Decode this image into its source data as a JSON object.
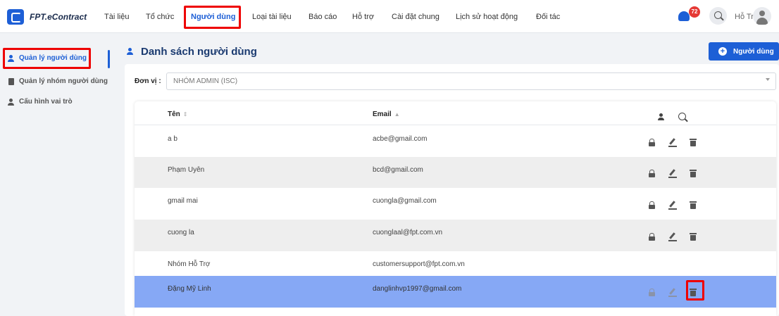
{
  "brand": {
    "name": "FPT.eContract"
  },
  "nav": {
    "items": [
      {
        "label": "Tài liệu",
        "active": false
      },
      {
        "label": "Tổ chức",
        "active": false
      },
      {
        "label": "Người dùng",
        "active": true
      },
      {
        "label": "Loại tài liệu",
        "active": false
      },
      {
        "label": "Báo cáo",
        "active": false
      },
      {
        "label": "Hỗ trợ",
        "active": false
      },
      {
        "label": "Cài đặt chung",
        "active": false
      },
      {
        "label": "Lịch sử hoạt động",
        "active": false
      },
      {
        "label": "Đối tác",
        "active": false
      }
    ],
    "notification_count": "72",
    "user_name": "Hỗ Trợ"
  },
  "sidebar": {
    "items": [
      {
        "label": "Quản lý người dùng",
        "icon": "person-icon",
        "active": true
      },
      {
        "label": "Quản lý nhóm người dùng",
        "icon": "document-icon",
        "active": false
      },
      {
        "label": "Cấu hình vai trò",
        "icon": "person-icon",
        "active": false
      }
    ]
  },
  "main": {
    "title": "Danh sách người dùng",
    "add_button_label": "Người dùng",
    "unit_label": "Đơn vị :",
    "unit_value": "NHÓM ADMIN (ISC)",
    "table": {
      "columns": [
        "Tên",
        "Email"
      ],
      "rows": [
        {
          "name": "a b",
          "email": "acbe@gmail.com",
          "actions": true,
          "style": "white"
        },
        {
          "name": "Phạm Uyên",
          "email": "bcd@gmail.com",
          "actions": true,
          "style": "gray"
        },
        {
          "name": "gmail mai",
          "email": "cuongla@gmail.com",
          "actions": true,
          "style": "white"
        },
        {
          "name": "cuong la",
          "email": "cuonglaal@fpt.com.vn",
          "actions": true,
          "style": "gray"
        },
        {
          "name": "Nhóm Hỗ Trợ",
          "email": "customersupport@fpt.com.vn",
          "actions": false,
          "style": "white"
        },
        {
          "name": "Đặng Mỹ Linh",
          "email": "danglinhvp1997@gmail.com",
          "actions": true,
          "style": "selected"
        }
      ]
    }
  },
  "colors": {
    "accent": "#1d5fd6",
    "selected_row": "#86a8f5",
    "highlight": "#ee0000"
  }
}
